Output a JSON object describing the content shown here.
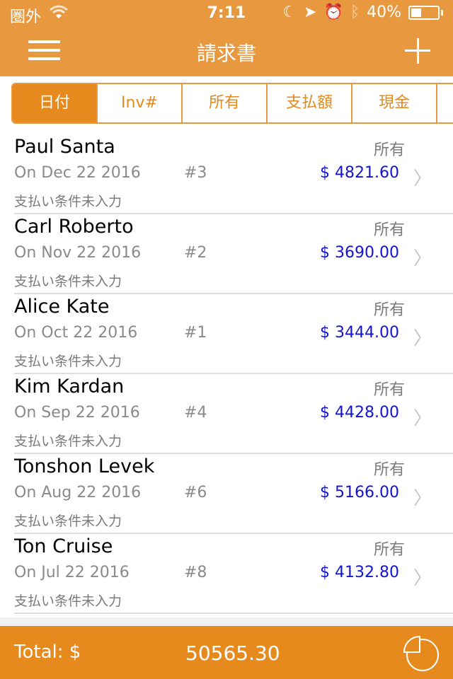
{
  "status_bar": {
    "carrier": "圏外",
    "time": "7:11",
    "battery": "40%",
    "battery_level": 0.4,
    "icons": [
      "wifi-icon",
      "moon-icon",
      "location-icon",
      "alarm-icon",
      "bluetooth-icon",
      "battery-icon"
    ]
  },
  "nav": {
    "title": "請求書",
    "menu_icon": "hamburger-icon",
    "add_icon": "plus-icon"
  },
  "tabs": [
    {
      "label": "日付",
      "active": true
    },
    {
      "label": "Inv#",
      "active": false
    },
    {
      "label": "所有",
      "active": false
    },
    {
      "label": "支払額",
      "active": false
    },
    {
      "label": "現金",
      "active": false
    }
  ],
  "invoices": [
    {
      "name": "Paul Santa",
      "status": "所有",
      "date": "On Dec 22 2016",
      "number": "#3",
      "amount": "$ 4821.60",
      "terms": "支払い条件未入力"
    },
    {
      "name": "Carl Roberto",
      "status": "所有",
      "date": "On Nov 22 2016",
      "number": "#2",
      "amount": "$ 3690.00",
      "terms": "支払い条件未入力"
    },
    {
      "name": "Alice Kate",
      "status": "所有",
      "date": "On Oct 22 2016",
      "number": "#1",
      "amount": "$ 3444.00",
      "terms": "支払い条件未入力"
    },
    {
      "name": "Kim Kardan",
      "status": "所有",
      "date": "On Sep 22 2016",
      "number": "#4",
      "amount": "$ 4428.00",
      "terms": "支払い条件未入力"
    },
    {
      "name": "Tonshon  Levek",
      "status": "所有",
      "date": "On Aug 22 2016",
      "number": "#6",
      "amount": "$ 5166.00",
      "terms": "支払い条件未入力"
    },
    {
      "name": "Ton  Cruise",
      "status": "所有",
      "date": "On Jul 22 2016",
      "number": "#8",
      "amount": "$ 4132.80",
      "terms": "支払い条件未入力"
    }
  ],
  "footer": {
    "total_label": "Total: $",
    "total_value": "50565.30",
    "chart_icon": "pie-chart-icon"
  },
  "colors": {
    "brand": "#e8993f",
    "accent": "#e68a1e",
    "amount": "#1414d0"
  }
}
